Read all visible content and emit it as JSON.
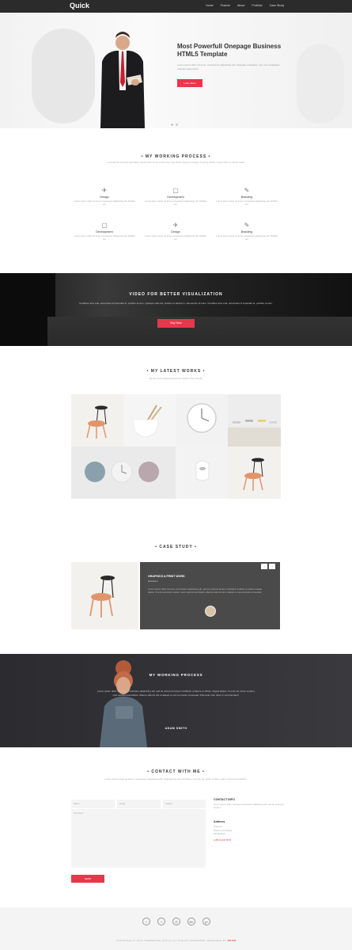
{
  "nav": {
    "logo": "Quick",
    "menu": [
      "Home",
      "Feature",
      "About",
      "Portfolio",
      "Case Study"
    ]
  },
  "hero": {
    "title": "Most Powerfull Onepage Business HTML5 Template",
    "text": "Lorem ipsum dolor sit amet, consectetur adipisicing elit. Voluptate voluptates, iure rem voluptatem magnam aspernatur.",
    "button": "Learn More"
  },
  "process": {
    "title": "• MY WORKING PROCESS •",
    "subtitle": "A wonderful serenity has taken possession of my entire soul, like these sweet mornings of spring which I enjoy with my whole heart.",
    "items": [
      {
        "icon": "rocket-icon",
        "glyph": "✈",
        "title": "Design",
        "desc": "Lorem ipsum dolor sit amet consectetur adipisicing elit. Mollitia vel."
      },
      {
        "icon": "document-icon",
        "glyph": "▢",
        "title": "Development",
        "desc": "Lorem ipsum dolor sit amet consectetur adipisicing elit. Mollitia vel."
      },
      {
        "icon": "pencil-icon",
        "glyph": "✎",
        "title": "Branding",
        "desc": "Lorem ipsum dolor sit amet consectetur adipisicing elit. Mollitia vel."
      },
      {
        "icon": "document-icon",
        "glyph": "▢",
        "title": "Development",
        "desc": "Lorem ipsum dolor sit amet consectetur adipisicing elit. Mollitia vel."
      },
      {
        "icon": "rocket-icon",
        "glyph": "✈",
        "title": "Design",
        "desc": "Lorem ipsum dolor sit amet consectetur adipisicing elit. Mollitia vel."
      },
      {
        "icon": "pencil-icon",
        "glyph": "✎",
        "title": "Branding",
        "desc": "Lorem ipsum dolor sit amet consectetur adipisicing elit. Mollitia vel."
      }
    ]
  },
  "video": {
    "title": "VIDEO FOR BETTER VISUALIZATION",
    "text": "Curabitur arcu erat, accumsan id imperdiet et, porttitor at sem. Quisque velit nisi, pretium ut lacinia in, elementum id enim. Curabitur arcu erat, accumsan id imperdiet et, porttitor at sem.",
    "button": "Buy Now"
  },
  "works": {
    "title": "• MY LATEST WORKS •",
    "subtitle": "Be the best Apple Experience! Gather Pixel Studio"
  },
  "case": {
    "title": "• CASE STUDY •",
    "item_title": "GRAPHICS & PRINT WORK",
    "item_sub": "Illustration",
    "item_text": "Lorem ipsum dolor sit amet, consectetur adipisicing elit, sed do eiusmod tempor incididunt ut labore et dolore magna aliqua. Ut enim ad minim veniam, quis nostrud exercitation ullamco laboris nisi ut aliquip ex ea commodo consequat.",
    "prev": "‹",
    "next": "›"
  },
  "testimonial": {
    "title": "MY WORKING PROCESS",
    "text": "Lorem ipsum dolor sit amet, consectetur adipisicing elit, sed do eiusmod tempor incididunt ut labore et dolore magna aliqua. Ut enim ad minim veniam, quis nostrud exercitation ullamco laboris nisi ut aliquip ex ea commodo consequat. Duis aute irure dolor in reprehenderit.",
    "author": "ADAM SMITH"
  },
  "contact": {
    "title": "• CONTACT WITH ME •",
    "subtitle": "Lorem ipsum dolor sit amet, consectetur adipisicing elit. Dignissimos eius similique. Ut enim ad minim veniam, quis nostrud exercitation.",
    "name_placeholder": "Name",
    "email_placeholder": "Email",
    "subject_placeholder": "Subject",
    "message_placeholder": "Comment",
    "send": "SEND",
    "info_title": "CONTACT INFO",
    "info_text": "Lorem ipsum dolor sit amet consectetur adipisicing elit, sed do eiusmod tempor.",
    "address_title": "Address",
    "address_lines": [
      "Road 22",
      "Dhanmondi Dhaka",
      "Bangladesh"
    ],
    "phone": "(+88) 01234 5678"
  },
  "footer": {
    "social": [
      {
        "icon": "facebook-icon",
        "glyph": "f"
      },
      {
        "icon": "twitter-icon",
        "glyph": "t"
      },
      {
        "icon": "dribbble-icon",
        "glyph": "◎"
      },
      {
        "icon": "behance-icon",
        "glyph": "Be"
      },
      {
        "icon": "google-plus-icon",
        "glyph": "g+"
      }
    ],
    "copyright": "COPYRIGHT © 2016 THEMEFACE QUICK ALL RIGHTS RESERVED. DESIGNED BY",
    "brand": "BOOM"
  },
  "colors": {
    "accent": "#e8374a",
    "nav": "#2b2b2b",
    "dark_section": "#3a3a3e"
  }
}
